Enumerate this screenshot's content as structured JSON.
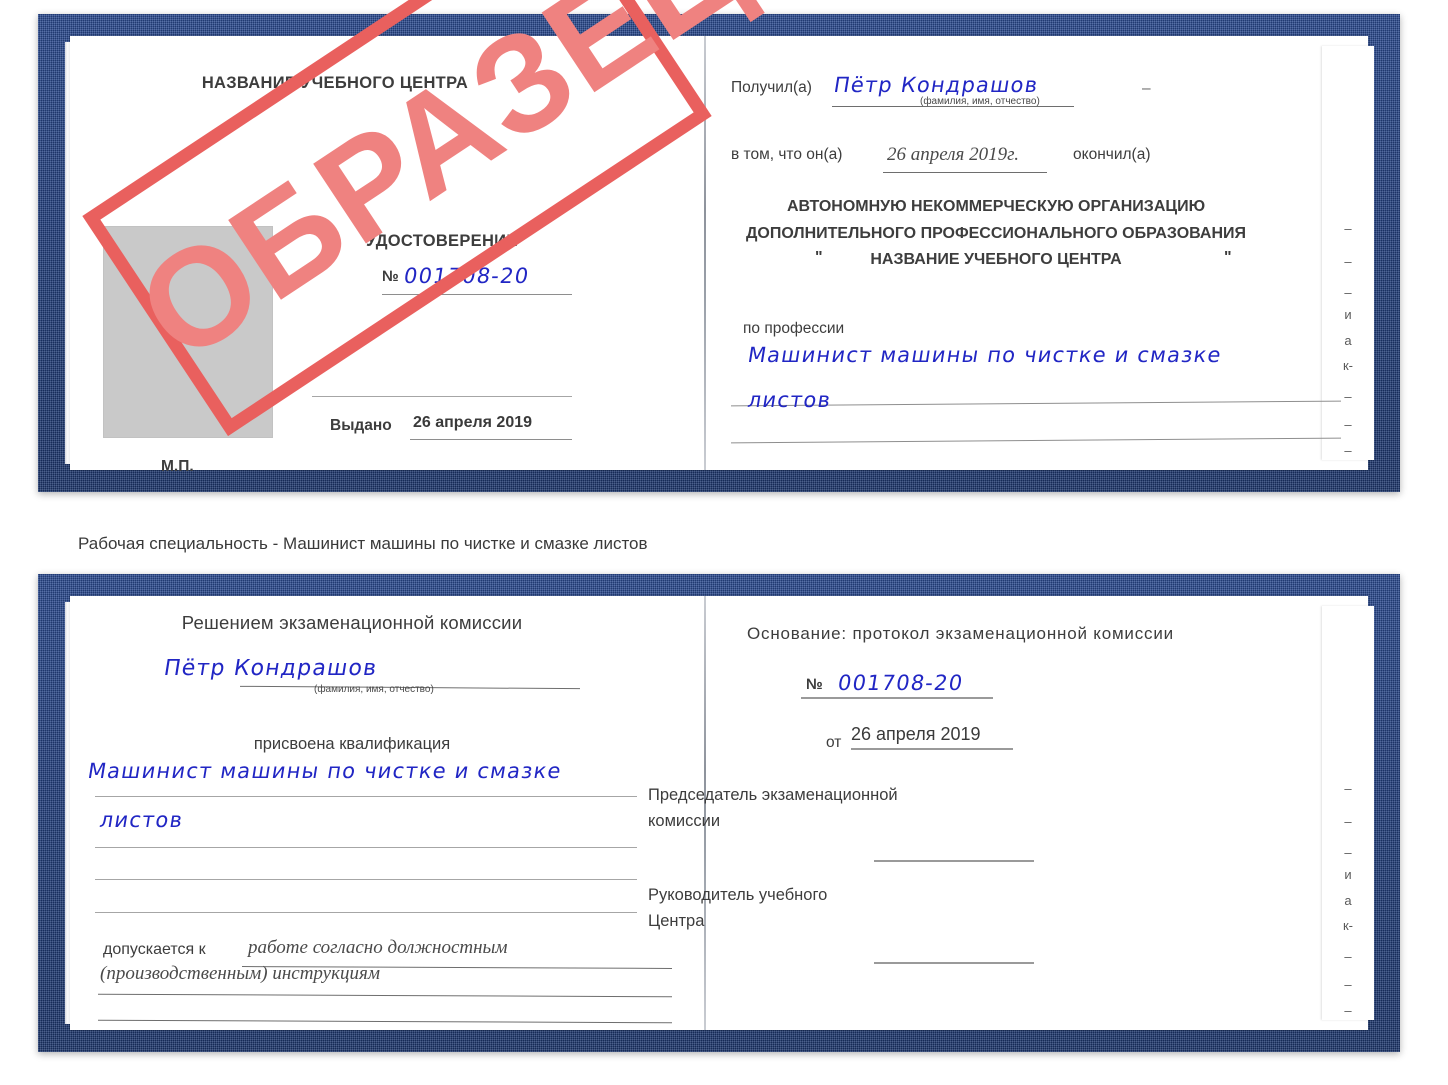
{
  "meta": {
    "caption": "Рабочая специальность - Машинист машины по чистке и смазке листов",
    "watermark": "ОБРАЗЕЦ",
    "colors": {
      "cover_blue": "#213e7d",
      "stamp_red": "#e9605e",
      "stamp_fill": "#ef8280",
      "handwriting_blue": "#2126c4",
      "photo_placeholder": "#c9c9c9",
      "page_white": "#ffffff"
    }
  },
  "certificate_top": {
    "left_page": {
      "org_title": "НАЗВАНИЕ УЧЕБНОГО ЦЕНТРА",
      "doc_type": "УДОСТОВЕРЕНИЕ",
      "number_label": "№",
      "number_value": "001708-20",
      "issued_label": "Выдано",
      "issued_value": "26 апреля 2019",
      "seal_label": "М.П.",
      "photo_placeholder": "photo-box"
    },
    "right_page": {
      "received_label": "Получил(а)",
      "received_value": "Пётр Кондрашов",
      "fio_hint": "(фамилия, имя, отчество)",
      "in_that_label": "в том, что он(а)",
      "in_that_value": "26 апреля 2019г.",
      "finished_label": "окончил(а)",
      "org_line1": "АВТОНОМНУЮ НЕКОММЕРЧЕСКУЮ ОРГАНИЗАЦИЮ",
      "org_line2": "ДОПОЛНИТЕЛЬНОГО ПРОФЕССИОНАЛЬНОГО ОБРАЗОВАНИЯ",
      "org_quote_open": "\"",
      "org_line3": "НАЗВАНИЕ УЧЕБНОГО ЦЕНТРА",
      "org_quote_close": "\"",
      "profession_label": "по профессии",
      "profession_line1": "Машинист машины по чистке и смазке",
      "profession_line2": "листов"
    },
    "edge_fragments": [
      "–",
      "–",
      "–",
      "и",
      "а",
      "к-",
      "–",
      "–",
      "–",
      "–"
    ]
  },
  "certificate_bottom": {
    "left_page": {
      "heading": "Решением экзаменационной комиссии",
      "name_value": "Пётр Кондрашов",
      "fio_hint": "(фамилия, имя, отчество)",
      "qualification_label": "присвоена квалификация",
      "qualification_line1": "Машинист машины по чистке и смазке",
      "qualification_line2": "листов",
      "admitted_label": "допускается к",
      "admitted_line1": "работе согласно должностным",
      "admitted_line2": "(производственным) инструкциям"
    },
    "right_page": {
      "basis_label": "Основание: протокол экзаменационной комиссии",
      "number_label": "№",
      "number_value": "001708-20",
      "date_label": "от",
      "date_value": "26 апреля 2019",
      "chairman_line1": "Председатель экзаменационной",
      "chairman_line2": "комиссии",
      "head_line1": "Руководитель учебного",
      "head_line2": "Центра"
    },
    "edge_fragments": [
      "–",
      "–",
      "–",
      "и",
      "а",
      "к-",
      "–",
      "–",
      "–",
      "–"
    ]
  }
}
